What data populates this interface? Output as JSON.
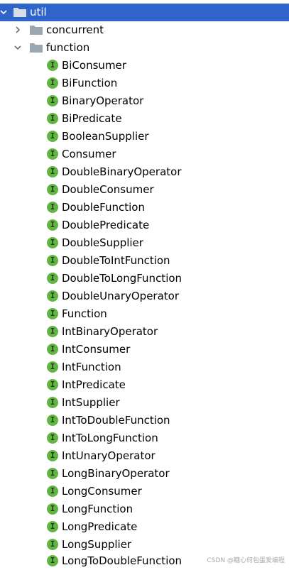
{
  "tree": {
    "root": {
      "label": "util",
      "expanded": true,
      "selected": true
    },
    "folders": [
      {
        "label": "concurrent",
        "expanded": false
      },
      {
        "label": "function",
        "expanded": true
      }
    ],
    "interface_badge": "I",
    "interfaces": [
      "BiConsumer",
      "BiFunction",
      "BinaryOperator",
      "BiPredicate",
      "BooleanSupplier",
      "Consumer",
      "DoubleBinaryOperator",
      "DoubleConsumer",
      "DoubleFunction",
      "DoublePredicate",
      "DoubleSupplier",
      "DoubleToIntFunction",
      "DoubleToLongFunction",
      "DoubleUnaryOperator",
      "Function",
      "IntBinaryOperator",
      "IntConsumer",
      "IntFunction",
      "IntPredicate",
      "IntSupplier",
      "IntToDoubleFunction",
      "IntToLongFunction",
      "IntUnaryOperator",
      "LongBinaryOperator",
      "LongConsumer",
      "LongFunction",
      "LongPredicate",
      "LongSupplier",
      "LongToDoubleFunction"
    ]
  },
  "watermark": "CSDN @糖心何包蛋爱编程",
  "colors": {
    "selection": "#2f65ca",
    "folder": "#9aa7b0",
    "interface_icon": "#62b543"
  }
}
